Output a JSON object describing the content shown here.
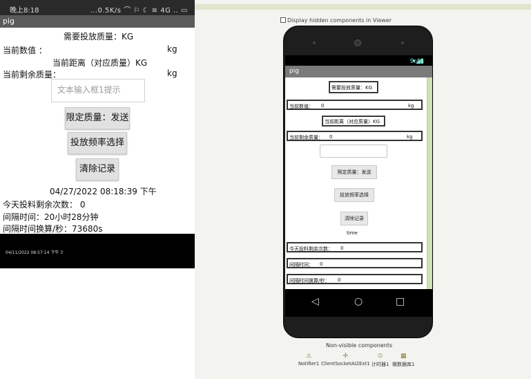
{
  "left_phone": {
    "status_left": "晚上8:18",
    "status_right": "...0.5K/s ⌒ ⚐ ☾ ≋ 4G .. ▭",
    "app_title": "pig",
    "required_mass_label": "需要投放质量：KG",
    "current_value_label": "当前数值 ：",
    "current_value_unit": "kg",
    "distance_label": "当前距离（对应质量）KG",
    "remaining_mass_label": "当前剩余质量：",
    "remaining_mass_unit": "kg",
    "textbox_hint": "文本输入框1提示",
    "send_button": "限定质量：发送",
    "freq_button": "投放频率选择",
    "clear_button": "清除记录",
    "datetime": "04/27/2022 08:18:39 下午",
    "remaining_times": "今天投料剩余次数： 0",
    "interval_time": "间隔时间：20小时28分钟",
    "interval_seconds": "间隔时间换算/秒：73680s",
    "notification": "04/11/2022 08:57:14 下午 3"
  },
  "designer": {
    "hidden_components_label": "Display hidden components in Viewer",
    "phone_time": "9:48",
    "app_title": "pig",
    "required_mass_label": "需要投放质量：KG",
    "current_value_label": "当前数值：",
    "current_value": "0",
    "current_value_unit": "kg",
    "distance_label": "当前距离（对应质量）KG",
    "remaining_mass_label": "当前剩余质量：",
    "remaining_mass_value": "0",
    "remaining_mass_unit": "kg",
    "send_button": "限定质量：发送",
    "freq_button": "投放频率选择",
    "clear_button": "清除记录",
    "time_label": "time",
    "remaining_times_label": "今天投料剩余次数：",
    "remaining_times_value": "0",
    "interval_label": "间隔时间：",
    "interval_value": "0",
    "interval_sec_label": "间隔时间换算/秒：",
    "interval_sec_value": "0",
    "nav": {
      "back": "◁",
      "home": "○",
      "recent": "□"
    },
    "nonvisible_title": "Non-visible components",
    "nonvisible": [
      {
        "icon": "⚠",
        "label": "Notifier1"
      },
      {
        "icon": "✢",
        "label": "ClientSocketAI2Ext1"
      },
      {
        "icon": "⏲",
        "label": "计时器1"
      },
      {
        "icon": "▦",
        "label": "微数据库1"
      }
    ]
  }
}
